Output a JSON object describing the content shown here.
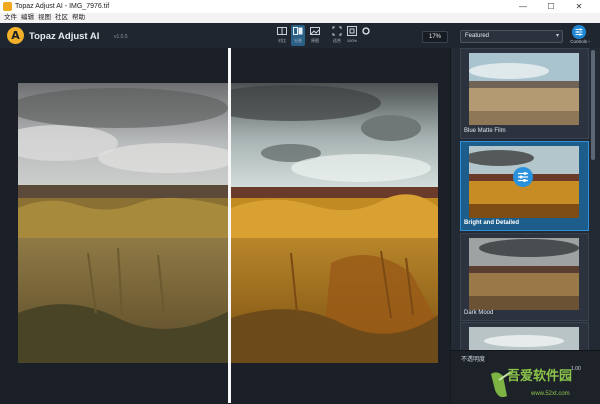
{
  "window": {
    "title": "Topaz Adjust AI - IMG_7976.tif",
    "minimize": "—",
    "maximize": "☐",
    "close": "✕"
  },
  "menu": {
    "items": [
      "文件",
      "编辑",
      "视图",
      "社区",
      "帮助"
    ]
  },
  "toolbar": {
    "logo_letter": "A",
    "app_name": "Topaz Adjust AI",
    "version": "v1.0.5",
    "tools": [
      {
        "label": "对比",
        "icon": "split-view-icon"
      },
      {
        "label": "分割",
        "icon": "side-by-side-icon",
        "active": true
      },
      {
        "label": "原图",
        "icon": "original-icon"
      },
      {
        "label": "适合",
        "icon": "fit-icon"
      },
      {
        "label": "100%",
        "icon": "actual-size-icon"
      },
      {
        "label": "",
        "icon": "pan-circle-icon"
      }
    ],
    "zoom": "17%",
    "preset_filter": "Featured",
    "controls_label": "Controls ›"
  },
  "presets": [
    {
      "name": "Blue Matte Film",
      "selected": false
    },
    {
      "name": "Bright and Detailed",
      "selected": true
    },
    {
      "name": "Dark Mood",
      "selected": false
    },
    {
      "name": "",
      "selected": false
    }
  ],
  "bottom": {
    "opacity_label": "不透明度",
    "opacity_value": "1.00"
  },
  "watermark": {
    "text": "吾爱软件园",
    "sub": "www.52xt.com"
  },
  "colors": {
    "accent": "#2f8fd8",
    "brand": "#f3b02a",
    "toolbar_bg": "#20262f",
    "panel_bg": "#242a33"
  }
}
